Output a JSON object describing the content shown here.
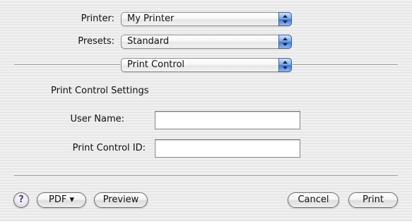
{
  "printer": {
    "label": "Printer:",
    "value": "My Printer"
  },
  "presets": {
    "label": "Presets:",
    "value": "Standard"
  },
  "panel": {
    "value": "Print Control"
  },
  "section": {
    "title": "Print Control Settings",
    "user_name_label": "User Name:",
    "user_name_value": "",
    "print_control_id_label": "Print Control ID:",
    "print_control_id_value": ""
  },
  "footer": {
    "help_label": "?",
    "pdf_label": "PDF ▾",
    "preview_label": "Preview",
    "cancel_label": "Cancel",
    "print_label": "Print"
  },
  "colors": {
    "window_stripe_light": "#f1f1f1",
    "window_stripe_dark": "#e7e7e7",
    "popup_arrow_blue": "#3d7ad6"
  }
}
